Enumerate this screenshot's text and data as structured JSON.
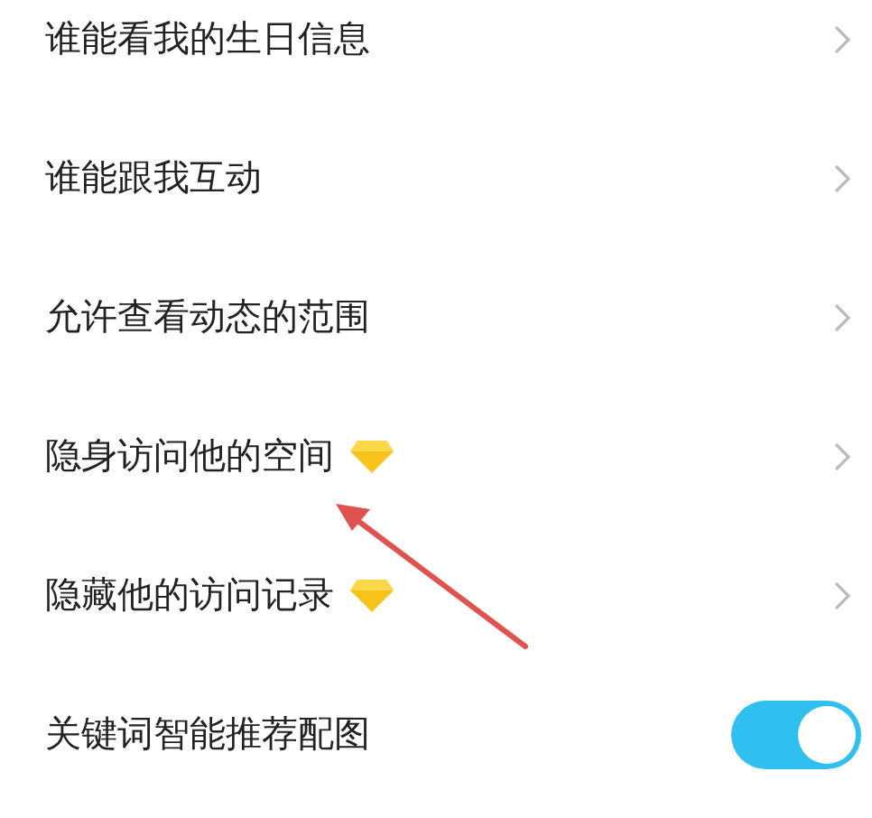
{
  "settings": [
    {
      "label": "谁能看我的生日信息",
      "kind": "link",
      "vip": false
    },
    {
      "label": "谁能跟我互动",
      "kind": "link",
      "vip": false
    },
    {
      "label": "允许查看动态的范围",
      "kind": "link",
      "vip": false
    },
    {
      "label": "隐身访问他的空间",
      "kind": "link",
      "vip": true
    },
    {
      "label": "隐藏他的访问记录",
      "kind": "link",
      "vip": true
    },
    {
      "label": "关键词智能推荐配图",
      "kind": "toggle",
      "vip": false,
      "on": true
    }
  ]
}
